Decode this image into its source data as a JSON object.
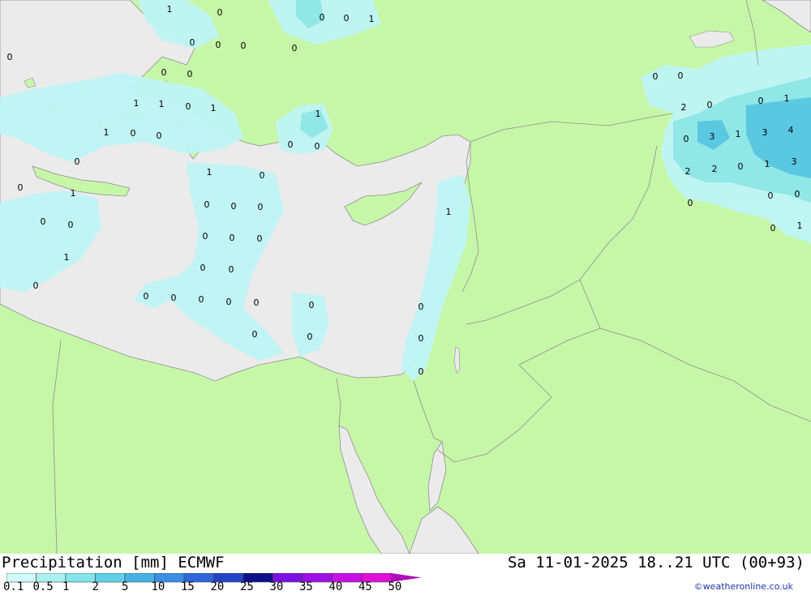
{
  "map": {
    "colors": {
      "land": "#c6f7a8",
      "sea": "#ebebeb",
      "border": "#8e8e8e",
      "precip_light": "#bff5f5",
      "precip_mid": "#8fe6ea",
      "precip_heavy": "#56c6e6"
    },
    "labels": [
      {
        "v": "1"
      },
      {
        "v": "0"
      },
      {
        "v": "0"
      },
      {
        "v": "0"
      },
      {
        "v": "1"
      },
      {
        "v": "0"
      },
      {
        "v": "0"
      },
      {
        "v": "0"
      },
      {
        "v": "0"
      },
      {
        "v": "0"
      },
      {
        "v": "0"
      },
      {
        "v": "0"
      },
      {
        "v": "1"
      },
      {
        "v": "1"
      },
      {
        "v": "0"
      },
      {
        "v": "1"
      },
      {
        "v": "1"
      },
      {
        "v": "0"
      },
      {
        "v": "0"
      },
      {
        "v": "1"
      },
      {
        "v": "0"
      },
      {
        "v": "0"
      },
      {
        "v": "0"
      },
      {
        "v": "1"
      },
      {
        "v": "0"
      },
      {
        "v": "0"
      },
      {
        "v": "1"
      },
      {
        "v": "0"
      },
      {
        "v": "0"
      },
      {
        "v": "0"
      },
      {
        "v": "0"
      },
      {
        "v": "0"
      },
      {
        "v": "0"
      },
      {
        "v": "0"
      },
      {
        "v": "0"
      },
      {
        "v": "1"
      },
      {
        "v": "1"
      },
      {
        "v": "0"
      },
      {
        "v": "0"
      },
      {
        "v": "0"
      },
      {
        "v": "0"
      },
      {
        "v": "0"
      },
      {
        "v": "0"
      },
      {
        "v": "0"
      },
      {
        "v": "0"
      },
      {
        "v": "0"
      },
      {
        "v": "0"
      },
      {
        "v": "0"
      },
      {
        "v": "0"
      },
      {
        "v": "0"
      },
      {
        "v": "0"
      },
      {
        "v": "0"
      },
      {
        "v": "2"
      },
      {
        "v": "0"
      },
      {
        "v": "0"
      },
      {
        "v": "1"
      },
      {
        "v": "0"
      },
      {
        "v": "3"
      },
      {
        "v": "1"
      },
      {
        "v": "3"
      },
      {
        "v": "4"
      },
      {
        "v": "2"
      },
      {
        "v": "2"
      },
      {
        "v": "0"
      },
      {
        "v": "1"
      },
      {
        "v": "3"
      },
      {
        "v": "0"
      },
      {
        "v": "0"
      },
      {
        "v": "0"
      },
      {
        "v": "0"
      },
      {
        "v": "1"
      },
      {
        "v": "0"
      }
    ]
  },
  "legend": {
    "title": "Precipitation [mm] ECMWF",
    "run": "Sa 11-01-2025 18..21 UTC (00+93)",
    "credit": "©weatheronline.co.uk",
    "bins": [
      {
        "label": "0.1",
        "color": "#d2fafa"
      },
      {
        "label": "0.5",
        "color": "#aaf0f0"
      },
      {
        "label": "1",
        "color": "#82e6ec"
      },
      {
        "label": "2",
        "color": "#5fd0ea"
      },
      {
        "label": "5",
        "color": "#47b0e6"
      },
      {
        "label": "10",
        "color": "#3a8ee4"
      },
      {
        "label": "15",
        "color": "#2f66dc"
      },
      {
        "label": "20",
        "color": "#2244c8"
      },
      {
        "label": "25",
        "color": "#10108c"
      },
      {
        "label": "30",
        "color": "#7a10e6"
      },
      {
        "label": "35",
        "color": "#9e10e6"
      },
      {
        "label": "40",
        "color": "#c810e6"
      },
      {
        "label": "45",
        "color": "#e010d8"
      },
      {
        "label": "50",
        "color": "#b010b8"
      }
    ]
  }
}
